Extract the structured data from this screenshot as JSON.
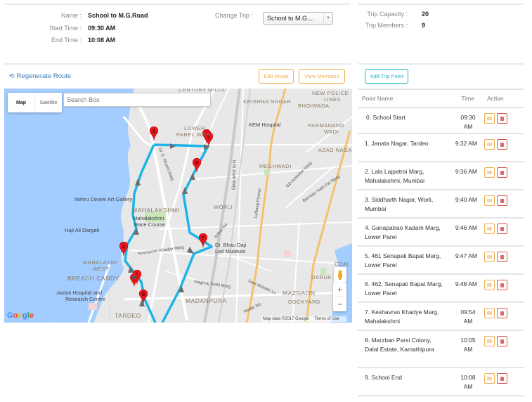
{
  "trip_info": {
    "name_label": "Name :",
    "name_value": "School to M.G.Road",
    "start_label": "Start Time :",
    "start_value": "09:30 AM",
    "end_label": "End Time :",
    "end_value": "10:08 AM",
    "change_trip_label": "Change Trip :",
    "change_trip_selected": "School to M.G...."
  },
  "trip_stats": {
    "capacity_label": "Trip Capacity :",
    "capacity_value": "20",
    "members_label": "Trip Members :",
    "members_value": "9"
  },
  "toolbar": {
    "regenerate_label": "Regenerate Route",
    "edit_route_label": "Edit Route",
    "view_members_label": "View Members",
    "add_trip_point_label": "Add Trip Point"
  },
  "map": {
    "type_map": "Map",
    "type_satellite": "Satellite",
    "search_placeholder": "Search Box",
    "attribution": "Map data ©2017 Google",
    "terms": "Terms of Use",
    "google": "Google",
    "labels": {
      "century_mills": "CENTURY MILLS",
      "krishna_nagar": "KRISHNA NAGAR",
      "new_police_lines": "NEW POLICE",
      "new_police_lines2": "LINES",
      "bhoiwada": "BHOIWADA",
      "lower_parel": "LOWER",
      "lower_parel2": "PAREL WEST",
      "kem": "KEM Hospital",
      "parmanand": "PARMANAND",
      "parmanand2": "WADI",
      "azad": "AZAD NAGAR",
      "meghwadi": "MEGHWADI",
      "nehru": "Nehru Centre Art Gallery",
      "mahalakshmi": "MAHALAKSHMI",
      "race_course": "Mahalakshmi",
      "race_course2": "Race Course",
      "worli": "WORLI",
      "haji_ali": "Haji Ali Dargah",
      "mahalaxmi_west": "MAHALAXMI",
      "mahalaxmi_west2": "WEST",
      "breach_candy": "BREACH CANDY",
      "jaslok": "Jaslok Hospital and",
      "jaslok2": "Research Centre",
      "tardeo": "TARDEO",
      "bhau_daji": "Dr. Bhau Daji",
      "bhau_daji2": "Lad Museum",
      "madanpura": "MADANPURA",
      "mazgaon": "MAZGAON",
      "dockyard": "DOCKYARD",
      "coal": "COAL B",
      "daruk": "DARUK",
      "keshavrao": "Keshavrao Khadye Marg",
      "moses": "Dr. E. Moses Marg",
      "nm_joshi": "N M Joshi Marg",
      "lalbaug": "Lalbaug Flyover",
      "ambedkar": "GD Ambekar Marg",
      "barrister": "Barrister Nath Pai Marg",
      "arthur": "Arthur Rd",
      "maghraj": "Maghraj Sethi Marg",
      "sant": "Sant Mohidin Ln",
      "nesbit": "Nesbit Rd"
    },
    "markers": [
      "1",
      "2",
      "3",
      "4",
      "5",
      "6",
      "7",
      "8"
    ]
  },
  "table": {
    "headers": {
      "point": "Point Name",
      "time": "Time",
      "action": "Action"
    },
    "rows": [
      {
        "idx": "0.",
        "name": "School Start",
        "time": "09:30 AM"
      },
      {
        "idx": "1.",
        "name": "Janata Nagar, Tardeo",
        "time": "9:32 AM"
      },
      {
        "idx": "2.",
        "name": "Lala Lajpatrai Marg, Mahalakshmi, Mumbai",
        "time": "9:36 AM"
      },
      {
        "idx": "3.",
        "name": "Siddharth Nagar, Worli, Mumbai",
        "time": "9:40 AM"
      },
      {
        "idx": "4.",
        "name": "Ganapatrao Kadam Marg, Lower Parel",
        "time": "9:46 AM"
      },
      {
        "idx": "5.",
        "name": "461 Senapati Bapat Marg, Lower Parel",
        "time": "9:47 AM"
      },
      {
        "idx": "6.",
        "name": "462, Senapati Bapat Marg, Lower Parel",
        "time": "9:48 AM"
      },
      {
        "idx": "7.",
        "name": "Keshavrao Khadye Marg, Mahalakshmi",
        "time": "09:54 AM"
      },
      {
        "idx": "8.",
        "name": "Marzban Parsi Colony, Dalal Estate, Kamathipura",
        "time": "10:05 AM"
      },
      {
        "idx": "9.",
        "name": "School End",
        "time": "10:08 AM"
      }
    ]
  },
  "colors": {
    "route": "#1fb4e8",
    "marker": "#e8141b",
    "orange": "#f0ad4e",
    "teal": "#26b5c0",
    "danger": "#d9534f",
    "link": "#3c7ab5"
  }
}
